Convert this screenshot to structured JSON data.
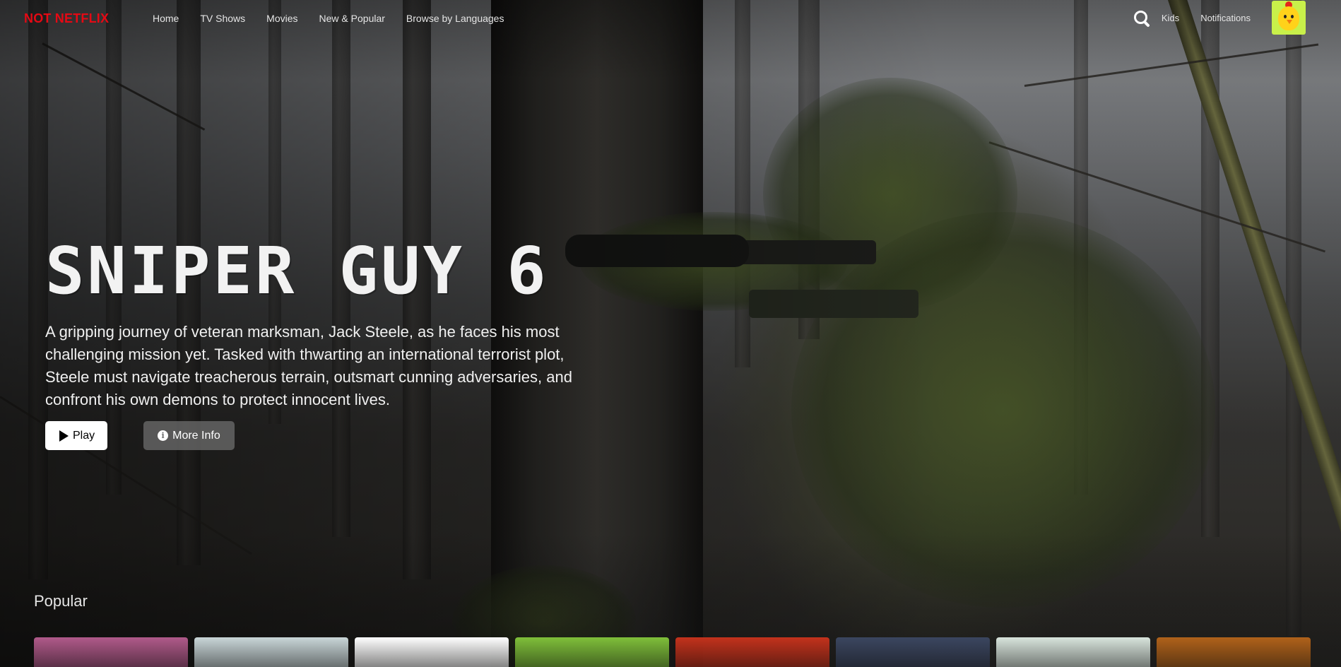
{
  "brand": "NOT NETFLIX",
  "nav": {
    "links": [
      "Home",
      "TV Shows",
      "Movies",
      "New & Popular",
      "Browse by Languages"
    ],
    "kids": "Kids",
    "notifications": "Notifications"
  },
  "hero": {
    "title": "SNIPER GUY 6",
    "description": "A gripping journey of veteran marksman, Jack Steele, as he faces his most challenging mission yet. Tasked with thwarting an international terrorist plot, Steele must navigate treacherous terrain, outsmart cunning adversaries, and confront his own demons to protect innocent lives.",
    "play_label": "Play",
    "info_label": "More Info"
  },
  "rows": [
    {
      "title": "Popular",
      "cards": [
        {
          "icon": "poster-thumbnail",
          "color": "#b05a8a"
        },
        {
          "icon": "poster-thumbnail",
          "color": "#c9d6d8"
        },
        {
          "icon": "poster-thumbnail",
          "color": "#ffffff"
        },
        {
          "icon": "poster-thumbnail",
          "color": "#7fbf3a"
        },
        {
          "icon": "poster-thumbnail",
          "color": "#c3321c"
        },
        {
          "icon": "poster-thumbnail",
          "color": "#3b4660"
        },
        {
          "icon": "poster-thumbnail",
          "color": "#d8e4dc"
        },
        {
          "icon": "poster-thumbnail",
          "color": "#b0621a"
        }
      ]
    }
  ],
  "colors": {
    "brand": "#e50914",
    "avatar_bg": "#c8f04a"
  }
}
